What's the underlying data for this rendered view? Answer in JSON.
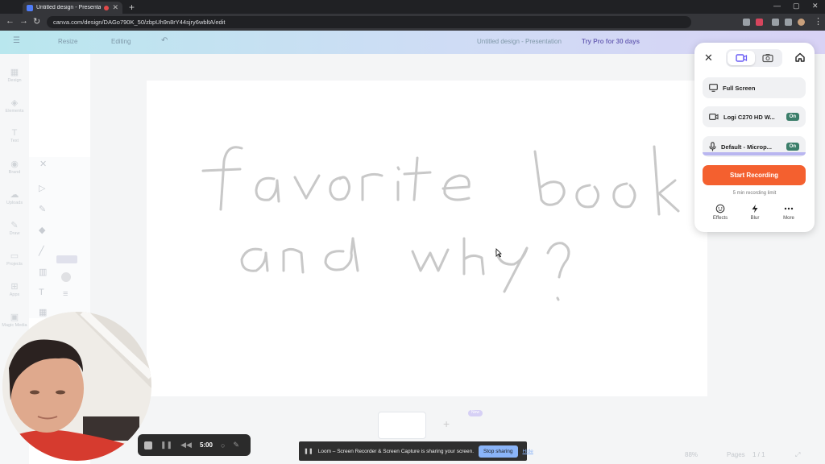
{
  "browser": {
    "tab_title": "Untitled design - Presentation",
    "url": "canva.com/design/DAGo790K_50/zbpUh9n8rY44sjry6wbltA/edit"
  },
  "canva": {
    "resize": "Resize",
    "editing": "Editing",
    "doc_title": "Untitled design - Presentation",
    "try_pro": "Try Pro for 30 days",
    "sidebar": [
      "Design",
      "Elements",
      "Text",
      "Brand",
      "Uploads",
      "Draw",
      "Projects",
      "Apps",
      "Magic Media"
    ],
    "zoom": "88%",
    "pages": "Pages",
    "page_count": "1 / 1",
    "new_badge": "New"
  },
  "canvas_text": {
    "line1": "favorite book",
    "line2": "and why?"
  },
  "loom": {
    "screen_option": "Full Screen",
    "camera_option": "Logi C270 HD W...",
    "camera_state": "On",
    "mic_option": "Default - Microp...",
    "mic_state": "On",
    "start_label": "Start Recording",
    "limit_text": "5 min recording limit",
    "tools": [
      "Effects",
      "Blur",
      "More"
    ]
  },
  "recorder": {
    "time": "5:00"
  },
  "share_bar": {
    "message": "Loom – Screen Recorder & Screen Capture is sharing your screen.",
    "stop_label": "Stop sharing",
    "hide_label": "Hide"
  },
  "colors": {
    "accent": "#f4602f",
    "on_badge": "#3b7e6a",
    "stop_share": "#8ab4f8"
  }
}
